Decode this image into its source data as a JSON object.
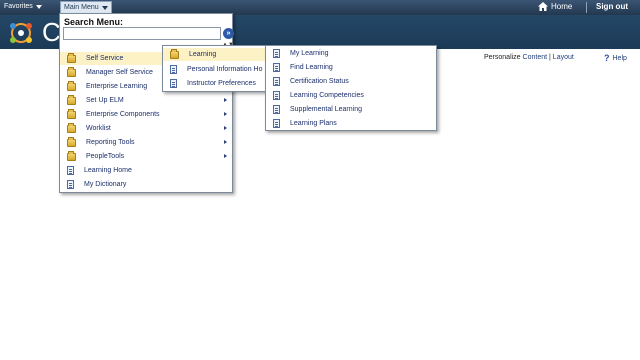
{
  "topbar": {
    "favorites_label": "Favorites",
    "main_menu_label": "Main Menu",
    "home_label": "Home",
    "signout_label": "Sign out"
  },
  "header": {
    "logo_letter": "C"
  },
  "utility": {
    "personalize_label": "Personalize",
    "content_label": "Content",
    "separator": "|",
    "layout_label": "Layout",
    "help_label": "Help",
    "help_icon_glyph": "?"
  },
  "main_menu": {
    "search_title": "Search Menu:",
    "search_value": "",
    "go_glyph": "»",
    "scroll_glyph": "▲▼",
    "items": [
      {
        "label": "Self Service",
        "icon": "folder-icon",
        "has_submenu": true,
        "highlighted": true
      },
      {
        "label": "Manager Self Service",
        "icon": "folder-icon",
        "has_submenu": false,
        "highlighted": false
      },
      {
        "label": "Enterprise Learning",
        "icon": "folder-icon",
        "has_submenu": false,
        "highlighted": false
      },
      {
        "label": "Set Up ELM",
        "icon": "folder-icon",
        "has_submenu": true,
        "highlighted": false
      },
      {
        "label": "Enterprise Components",
        "icon": "folder-icon",
        "has_submenu": true,
        "highlighted": false
      },
      {
        "label": "Worklist",
        "icon": "folder-icon",
        "has_submenu": true,
        "highlighted": false
      },
      {
        "label": "Reporting Tools",
        "icon": "folder-icon",
        "has_submenu": true,
        "highlighted": false
      },
      {
        "label": "PeopleTools",
        "icon": "folder-icon",
        "has_submenu": true,
        "highlighted": false
      },
      {
        "label": "Learning Home",
        "icon": "document-icon",
        "has_submenu": false,
        "highlighted": false
      },
      {
        "label": "My Dictionary",
        "icon": "document-icon",
        "has_submenu": false,
        "highlighted": false
      }
    ]
  },
  "self_service_menu": {
    "items": [
      {
        "label": "Learning",
        "icon": "folder-icon",
        "highlighted": true
      },
      {
        "label": "Personal Information Ho",
        "icon": "document-icon",
        "highlighted": false
      },
      {
        "label": "Instructor Preferences",
        "icon": "document-icon",
        "highlighted": false
      }
    ]
  },
  "learning_menu": {
    "items": [
      {
        "label": "My Learning",
        "icon": "document-icon"
      },
      {
        "label": "Find Learning",
        "icon": "document-icon"
      },
      {
        "label": "Certification Status",
        "icon": "document-icon"
      },
      {
        "label": "Learning Competencies",
        "icon": "document-icon"
      },
      {
        "label": "Supplemental Learning",
        "icon": "document-icon"
      },
      {
        "label": "Learning Plans",
        "icon": "document-icon"
      }
    ]
  },
  "colors": {
    "topbar": "#2b4462",
    "banner": "#1f3f5e",
    "highlight": "#fdf2c5",
    "link": "#1c2f6b"
  }
}
